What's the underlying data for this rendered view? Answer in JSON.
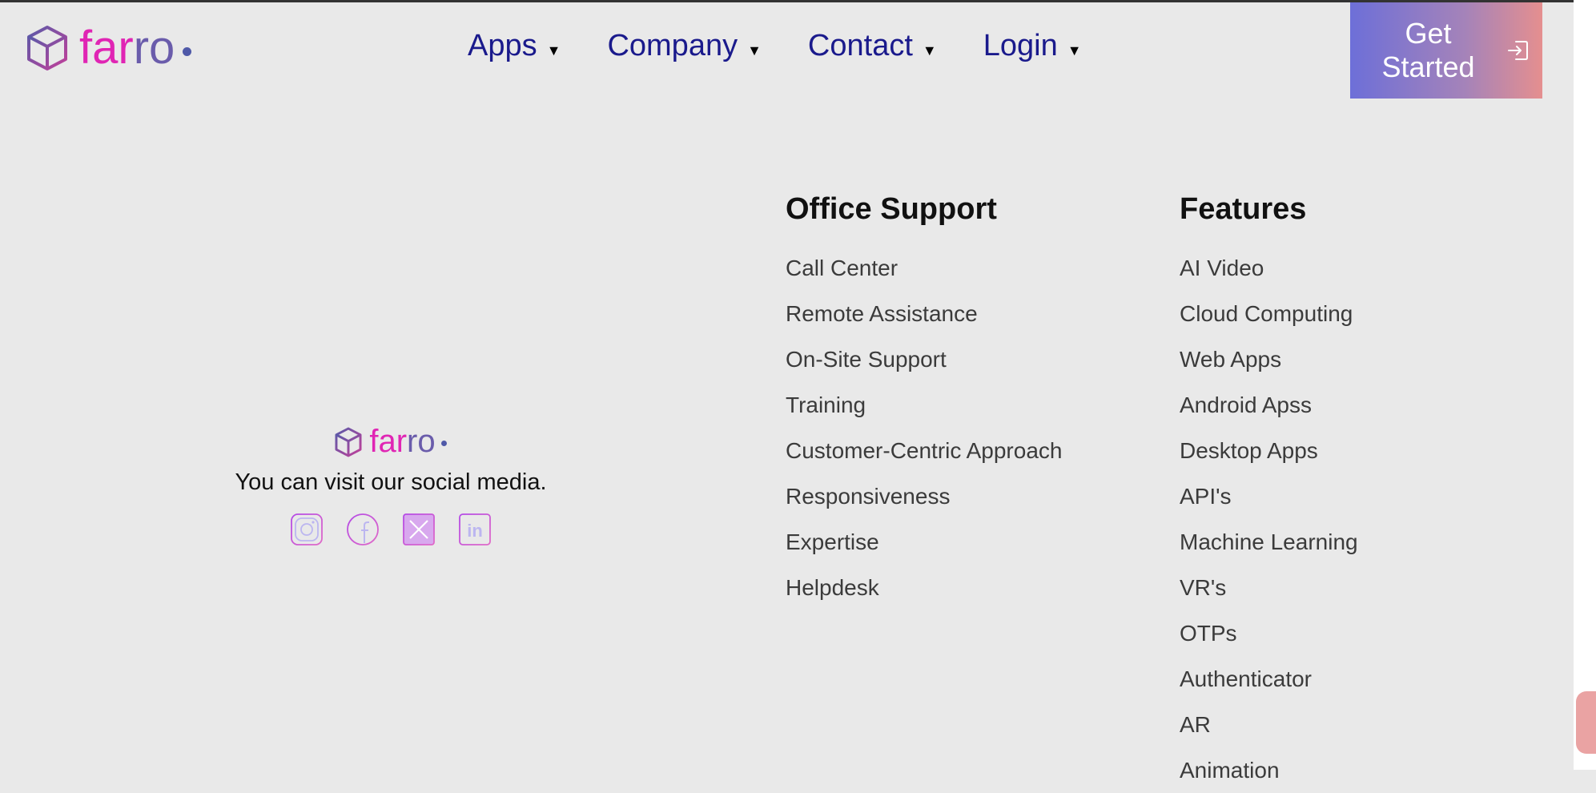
{
  "header": {
    "logo": {
      "far": "far",
      "ro": "ro"
    },
    "nav": [
      {
        "label": "Apps"
      },
      {
        "label": "Company"
      },
      {
        "label": "Contact"
      },
      {
        "label": "Login"
      }
    ],
    "cta": {
      "label_line1": "Get",
      "label_line2": "Started",
      "icon": "login-icon"
    }
  },
  "brand": {
    "logo": {
      "far": "far",
      "ro": "ro"
    },
    "tagline": "You can visit our social media.",
    "socials": [
      "instagram-icon",
      "facebook-icon",
      "x-icon",
      "linkedin-icon"
    ]
  },
  "columns": {
    "office": {
      "heading": "Office Support",
      "items": [
        "Call Center",
        "Remote Assistance",
        "On-Site Support",
        "Training",
        "Customer-Centric Approach",
        "Responsiveness",
        "Expertise",
        "Helpdesk"
      ]
    },
    "features": {
      "heading": "Features",
      "items": [
        "AI Video",
        "Cloud Computing",
        "Web Apps",
        "Android Apss",
        "Desktop Apps",
        "API's",
        "Machine Learning",
        "VR's",
        "OTPs",
        "Authenticator",
        "AR",
        "Animation"
      ]
    }
  },
  "colors": {
    "background": "#e9e9e9",
    "nav_text": "#1a1a8c",
    "logo_pink": "#e025b4",
    "logo_purple": "#6a5cab",
    "cta_gradient_start": "#6d6fd8",
    "cta_gradient_end": "#e58f8f",
    "scroll_thumb": "#eaa3a3"
  }
}
